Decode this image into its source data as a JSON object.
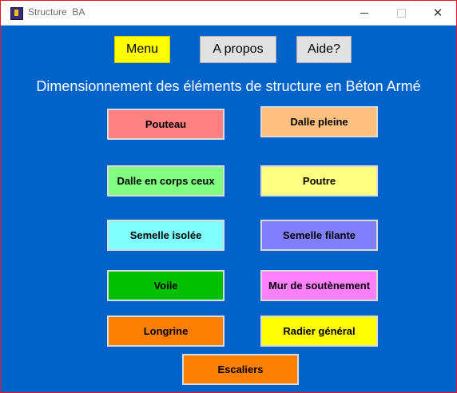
{
  "window": {
    "title": "Structure  BA",
    "close_glyph": "✕"
  },
  "toolbar": {
    "menu_label": "Menu",
    "apropos_label": "A propos",
    "aide_label": "Aide?"
  },
  "heading": "Dimensionnement des éléments de structure en Béton Armé",
  "elements": {
    "poteau": {
      "label": "Pouteau",
      "color": "#ff8080"
    },
    "dalle_pleine": {
      "label": "Dalle pleine",
      "color": "#ffc080"
    },
    "dalle_corps_creux": {
      "label": "Dalle en corps ceux",
      "color": "#80ff80"
    },
    "poutre": {
      "label": "Poutre",
      "color": "#ffff80"
    },
    "semelle_isolee": {
      "label": "Semelle isolée",
      "color": "#80ffff"
    },
    "semelle_filante": {
      "label": "Semelle filante",
      "color": "#8080ff"
    },
    "voile": {
      "label": "Voile",
      "color": "#00c000"
    },
    "mur_soutenement": {
      "label": "Mur de soutènement",
      "color": "#ff80ff"
    },
    "longrine": {
      "label": "Longrine",
      "color": "#ff8000"
    },
    "radier_general": {
      "label": "Radier général",
      "color": "#ffff00"
    },
    "escaliers": {
      "label": "Escaliers",
      "color": "#ff8000"
    }
  }
}
